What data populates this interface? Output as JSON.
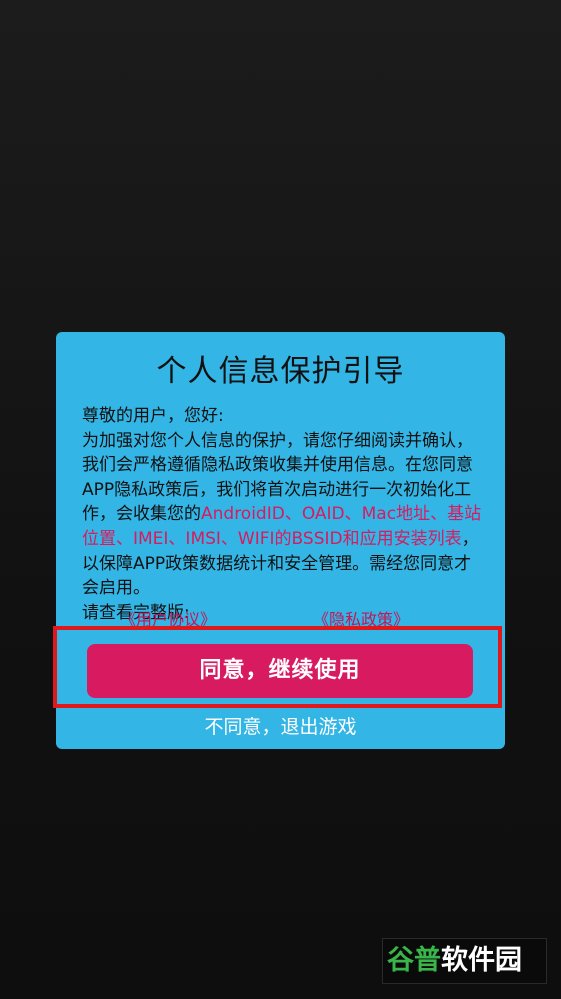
{
  "dialog": {
    "title": "个人信息保护引导",
    "greeting": "尊敬的用户，您好:",
    "body_part1": " 为加强对您个人信息的保护，请您仔细阅读并确认，我们会严格遵循隐私政策收集并使用信息。在您同意APP隐私政策后，我们将首次启动进行一次初始化工作，会收集您的",
    "body_highlight": "AndroidID、OAID、Mac地址、基站位置、IMEI、IMSI、WIFI的BSSID和应用安装列表",
    "body_part2": "，以保障APP政策数据统计和安全管理。需经您同意才会启用。",
    "view_full": "请查看完整版:",
    "link_user_agreement": "《用户协议》",
    "link_privacy_policy": "《隐私政策》",
    "agree_label": "同意，继续使用",
    "decline_label": "不同意，退出游戏"
  },
  "watermark": {
    "part1": "谷普",
    "part2": "软件园"
  },
  "colors": {
    "dialog_bg": "#33b5e5",
    "accent_pink": "#d81b60",
    "highlight_border": "#e0181b"
  }
}
